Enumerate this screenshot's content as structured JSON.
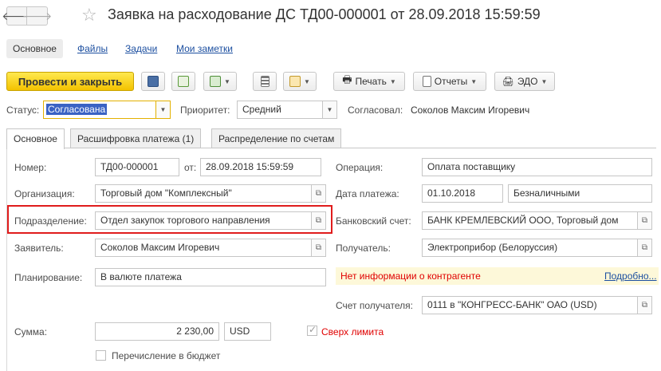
{
  "window": {
    "title": "Заявка на расходование ДС ТД00-000001 от 28.09.2018 15:59:59"
  },
  "section_tabs": [
    "Основное",
    "Файлы",
    "Задачи",
    "Мои заметки"
  ],
  "toolbar": {
    "post_close": "Провести и закрыть",
    "print": "Печать",
    "reports": "Отчеты",
    "edo": "ЭДО"
  },
  "status": {
    "label": "Статус:",
    "value": "Согласована",
    "priority_label": "Приоритет:",
    "priority_value": "Средний",
    "approved_label": "Согласовал:",
    "approved_value": "Соколов Максим Игоревич"
  },
  "tabs": [
    "Основное",
    "Расшифровка платежа (1)",
    "Распределение по счетам"
  ],
  "form": {
    "number_label": "Номер:",
    "number_value": "ТД00-000001",
    "from_label": "от:",
    "date_value": "28.09.2018 15:59:59",
    "operation_label": "Операция:",
    "operation_value": "Оплата поставщику",
    "org_label": "Организация:",
    "org_value": "Торговый дом \"Комплексный\"",
    "pay_date_label": "Дата платежа:",
    "pay_date_value": "01.10.2018",
    "pay_form_value": "Безналичными",
    "dept_label": "Подразделение:",
    "dept_value": "Отдел закупок торгового направления",
    "bank_label": "Банковский счет:",
    "bank_value": "БАНК КРЕМЛЕВСКИЙ ООО, Торговый дом",
    "applicant_label": "Заявитель:",
    "applicant_value": "Соколов Максим Игоревич",
    "recipient_label": "Получатель:",
    "recipient_value": "Электроприбор (Белоруссия)",
    "planning_label": "Планирование:",
    "planning_value": "В валюте платежа",
    "warning": "Нет информации о контрагенте",
    "more_link": "Подробно...",
    "recipient_account_label": "Счет получателя:",
    "recipient_account_value": "0111 в \"КОНГРЕСС-БАНК\" ОАО (USD)",
    "sum_label": "Сумма:",
    "sum_value": "2 230,00",
    "currency_value": "USD",
    "over_limit_label": "Сверх лимита",
    "budget_label": "Перечисление в бюджет"
  },
  "colors": {
    "primary_button": "#f3c200",
    "link": "#1c4fa0",
    "warning_text": "#e00000",
    "highlight_border": "#e01c1c",
    "selected_text_bg": "#3a62c4"
  }
}
